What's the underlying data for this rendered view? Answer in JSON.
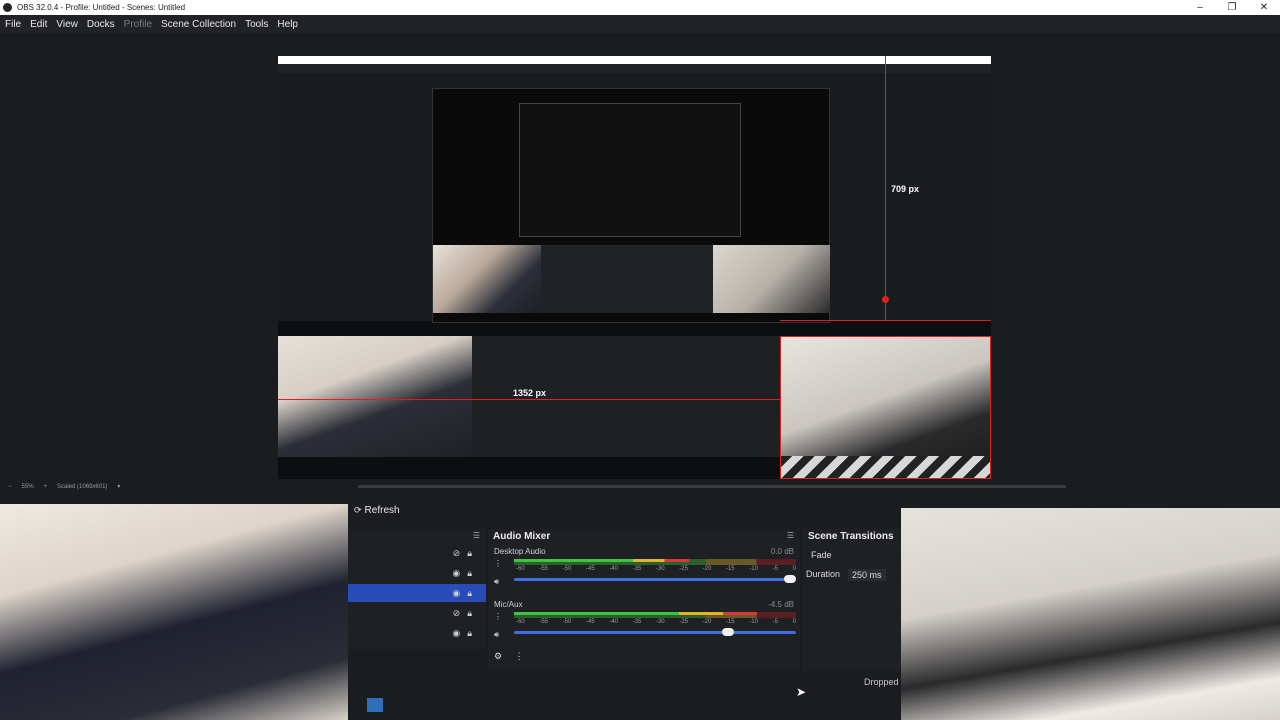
{
  "window": {
    "title": "OBS 32.0.4 - Profile: Untitled - Scenes: Untitled",
    "controls": [
      "minimize-icon",
      "restore-icon",
      "close-icon"
    ]
  },
  "menu": {
    "file": "File",
    "edit": "Edit",
    "view": "View",
    "docks": "Docks",
    "profile": "Profile",
    "scene_collection": "Scene Collection",
    "tools": "Tools",
    "help": "Help"
  },
  "preview": {
    "measure_vertical": "709 px",
    "measure_horizontal": "1352 px",
    "zoom": "55%",
    "scaled": "Scaled (1069x601)"
  },
  "docks": {
    "refresh": "Refresh",
    "mixer": {
      "title": "Audio Mixer",
      "channels": [
        {
          "name": "Desktop Audio",
          "db": "0.0 dB",
          "level": 0.62,
          "volume": 1.0
        },
        {
          "name": "Mic/Aux",
          "db": "-4.5 dB",
          "level": 0.86,
          "volume": 0.78
        }
      ],
      "ticks": [
        "-60",
        "-55",
        "-50",
        "-45",
        "-40",
        "-35",
        "-30",
        "-25",
        "-20",
        "-15",
        "-10",
        "-5",
        "0"
      ]
    },
    "transitions": {
      "title": "Scene Transitions",
      "type": "Fade",
      "duration_label": "Duration",
      "duration_value": "250 ms"
    },
    "dropped": "Dropped"
  },
  "colors": {
    "accent": "#284cb8",
    "selection_red": "#e02020"
  }
}
